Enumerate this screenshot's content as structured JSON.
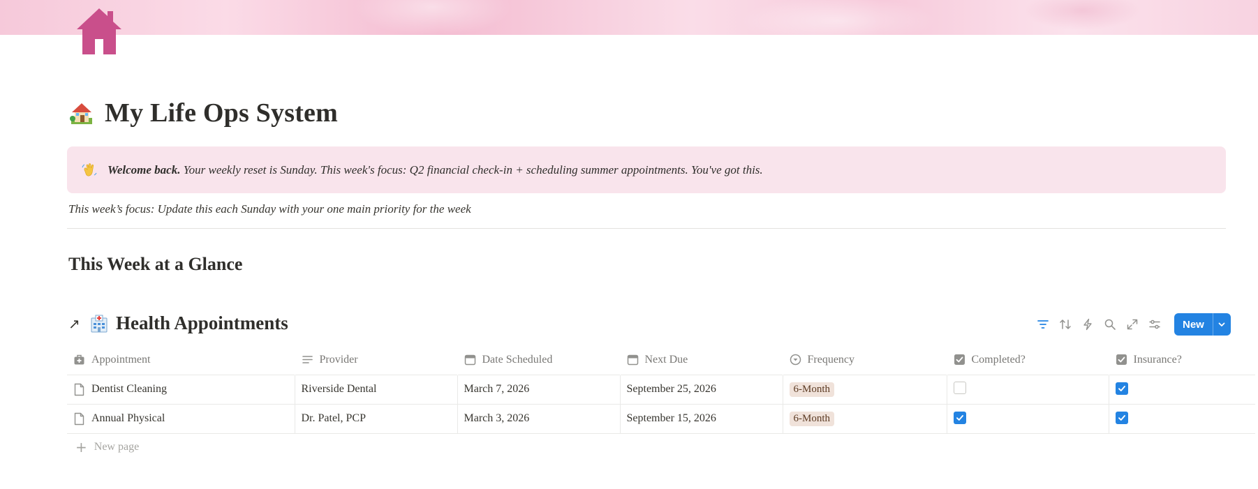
{
  "page": {
    "title": "My Life Ops System",
    "title_emoji": "house-with-garden-icon",
    "page_icon": "home-icon",
    "cover_color": "#f6c9da"
  },
  "callout": {
    "icon": "waving-hand-icon",
    "bold": "Welcome back.",
    "text": " Your weekly reset is Sunday. This week's focus:  Q2 financial check-in + scheduling summer appointments. You've got this."
  },
  "focus_line": "This week’s focus: Update this each Sunday with your one main priority for the week",
  "section_heading": "This Week at a Glance",
  "database": {
    "title": "Health Appointments",
    "emoji": "hospital-icon",
    "new_button": "New",
    "toolbar_icons": [
      "filter-icon",
      "sort-icon",
      "automation-icon",
      "search-icon",
      "expand-icon",
      "settings-icon"
    ],
    "columns": [
      {
        "label": "Appointment",
        "icon": "medkit-icon"
      },
      {
        "label": "Provider",
        "icon": "text-lines-icon"
      },
      {
        "label": "Date Scheduled",
        "icon": "calendar-icon"
      },
      {
        "label": "Next Due",
        "icon": "calendar-icon"
      },
      {
        "label": "Frequency",
        "icon": "select-icon"
      },
      {
        "label": "Completed?",
        "icon": "checkbox-icon"
      },
      {
        "label": "Insurance?",
        "icon": "checkbox-icon"
      }
    ],
    "rows": [
      {
        "name": "Dentist Cleaning",
        "provider": "Riverside Dental",
        "date_scheduled": "March 7, 2026",
        "next_due": "September 25, 2026",
        "frequency": "6-Month",
        "completed": false,
        "insurance": true
      },
      {
        "name": "Annual Physical",
        "provider": "Dr. Patel, PCP",
        "date_scheduled": "March 3, 2026",
        "next_due": "September 15, 2026",
        "frequency": "6-Month",
        "completed": true,
        "insurance": true
      }
    ],
    "new_page": "New page",
    "accent_color": "#2383e2",
    "tag_color": "#f0e2da"
  }
}
